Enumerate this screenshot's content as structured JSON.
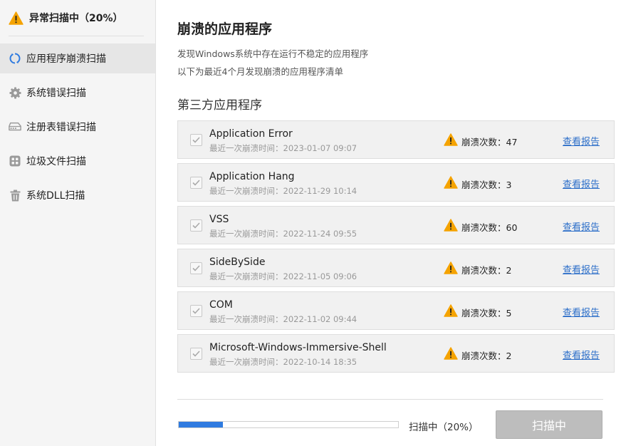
{
  "sidebar": {
    "status": "异常扫描中（20%）",
    "items": [
      {
        "label": "应用程序崩溃扫描",
        "icon": "refresh-icon",
        "active": true
      },
      {
        "label": "系统错误扫描",
        "icon": "gear-icon",
        "active": false
      },
      {
        "label": "注册表错误扫描",
        "icon": "registry-icon",
        "active": false
      },
      {
        "label": "垃圾文件扫描",
        "icon": "junk-files-icon",
        "active": false
      },
      {
        "label": "系统DLL扫描",
        "icon": "trash-icon",
        "active": false
      }
    ]
  },
  "main": {
    "title": "崩溃的应用程序",
    "desc1": "发现Windows系统中存在运行不稳定的应用程序",
    "desc2": "以下为最近4个月发现崩溃的应用程序清单",
    "section": "第三方应用程序",
    "apps": [
      {
        "name": "Application Error",
        "time": "最近一次崩溃时间：2023-01-07 09:07",
        "count": "崩溃次数：47",
        "link": "查看报告"
      },
      {
        "name": "Application Hang",
        "time": "最近一次崩溃时间：2022-11-29 10:14",
        "count": "崩溃次数：3",
        "link": "查看报告"
      },
      {
        "name": "VSS",
        "time": "最近一次崩溃时间：2022-11-24 09:55",
        "count": "崩溃次数：60",
        "link": "查看报告"
      },
      {
        "name": "SideBySide",
        "time": "最近一次崩溃时间：2022-11-05 09:06",
        "count": "崩溃次数：2",
        "link": "查看报告"
      },
      {
        "name": "COM",
        "time": "最近一次崩溃时间：2022-11-02 09:44",
        "count": "崩溃次数：5",
        "link": "查看报告"
      },
      {
        "name": "Microsoft-Windows-Immersive-Shell",
        "time": "最近一次崩溃时间：2022-10-14 18:35",
        "count": "崩溃次数：2",
        "link": "查看报告"
      }
    ]
  },
  "footer": {
    "progress": 0.2,
    "progress_text": "扫描中（20%）",
    "button_label": "扫描中"
  },
  "colors": {
    "accent": "#2f7be0",
    "link": "#2d6fc9",
    "warning": "#f5a300"
  }
}
